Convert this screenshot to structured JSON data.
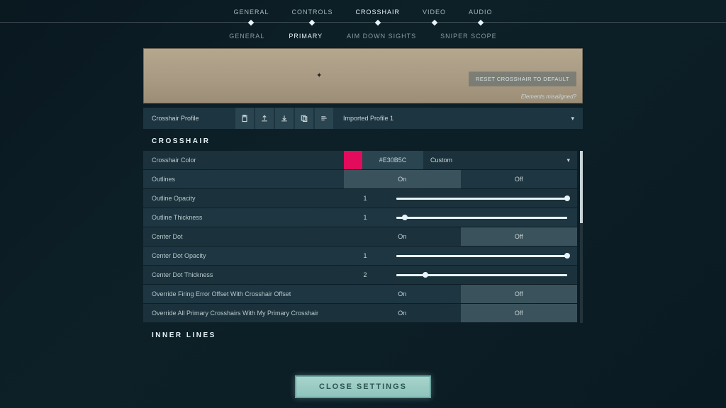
{
  "mainTabs": [
    "GENERAL",
    "CONTROLS",
    "CROSSHAIR",
    "VIDEO",
    "AUDIO"
  ],
  "mainTabActive": 2,
  "subTabs": [
    "GENERAL",
    "PRIMARY",
    "AIM DOWN SIGHTS",
    "SNIPER SCOPE"
  ],
  "subTabActive": 1,
  "resetBtn": "RESET CROSSHAIR TO DEFAULT",
  "misaligned": "Elements misaligned?",
  "profileLabel": "Crosshair Profile",
  "profileValue": "Imported Profile 1",
  "sectionCrosshair": "CROSSHAIR",
  "sectionInner": "INNER LINES",
  "rows": {
    "color": {
      "label": "Crosshair Color",
      "code": "#E30B5C",
      "mode": "Custom",
      "swatch": "#e30b5c"
    },
    "outlines": {
      "label": "Outlines",
      "on": "On",
      "off": "Off",
      "selected": "On"
    },
    "outlineOpacity": {
      "label": "Outline Opacity",
      "value": "1",
      "pct": 100
    },
    "outlineThickness": {
      "label": "Outline Thickness",
      "value": "1",
      "pct": 17
    },
    "centerDot": {
      "label": "Center Dot",
      "on": "On",
      "off": "Off",
      "selected": "Off"
    },
    "centerDotOpacity": {
      "label": "Center Dot Opacity",
      "value": "1",
      "pct": 100
    },
    "centerDotThickness": {
      "label": "Center Dot Thickness",
      "value": "2",
      "pct": 17
    },
    "overrideFiring": {
      "label": "Override Firing Error Offset With Crosshair Offset",
      "on": "On",
      "off": "Off",
      "selected": "Off"
    },
    "overrideAll": {
      "label": "Override All Primary Crosshairs With My Primary Crosshair",
      "on": "On",
      "off": "Off",
      "selected": "Off"
    }
  },
  "closeBtn": "CLOSE SETTINGS"
}
